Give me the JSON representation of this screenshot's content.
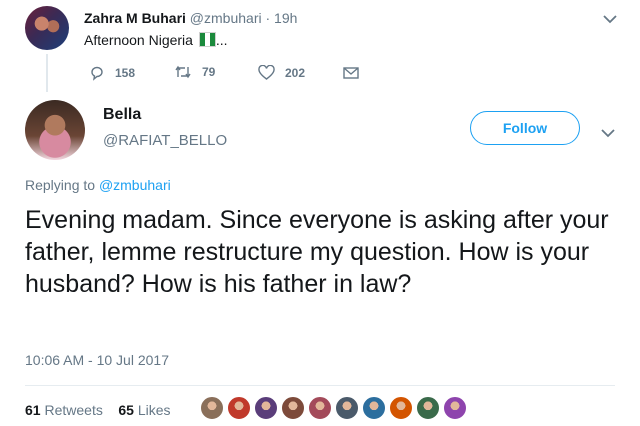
{
  "parent_tweet": {
    "name": "Zahra M Buhari",
    "handle": "@zmbuhari · 19h",
    "text": "Afternoon Nigeria",
    "text_suffix": "...",
    "reply_count": "158",
    "retweet_count": "79",
    "like_count": "202"
  },
  "main_tweet": {
    "name": "Bella",
    "handle": "@RAFIAT_BELLO",
    "follow_label": "Follow",
    "replying_prefix": "Replying to",
    "replying_handle": "@zmbuhari",
    "text": "Evening madam. Since everyone is asking after your father, lemme restructure my question. How is your husband? How is his father in law?",
    "timestamp": "10:06 AM - 10 Jul 2017",
    "retweets_count": "61",
    "retweets_label": "Retweets",
    "likes_count": "65",
    "likes_label": "Likes"
  },
  "liker_colors": [
    "#8a6f5a",
    "#c0392b",
    "#5a3d7a",
    "#7d4a3a",
    "#a34a5a",
    "#4a5a6a",
    "#2c6e9e",
    "#d35400",
    "#3a6a4a",
    "#8e44ad"
  ],
  "colors": {
    "accent": "#1da1f2",
    "muted": "#657786",
    "text": "#14171a"
  }
}
